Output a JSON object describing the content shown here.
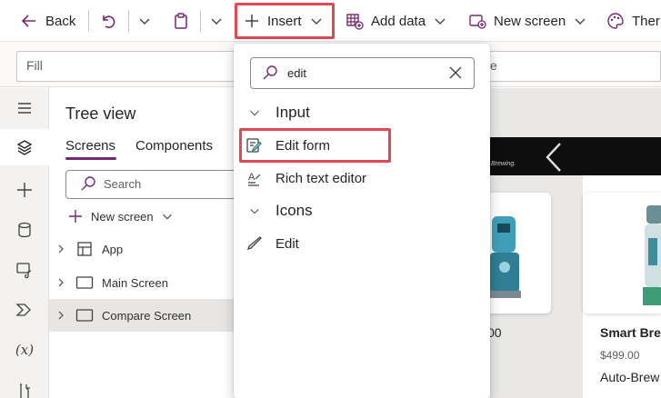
{
  "toolbar": {
    "back_label": "Back",
    "insert_label": "Insert",
    "add_data_label": "Add data",
    "new_screen_label": "New screen",
    "theme_label": "Ther",
    "highlight_color": "#e3474f"
  },
  "formula_bar": {
    "property_value": "Fill",
    "partial_text": "e"
  },
  "left_rail": {
    "icons": [
      "hamburger-icon",
      "layers-icon",
      "plus-icon",
      "database-icon",
      "media-icon",
      "power-automate-icon",
      "variables-icon",
      "tools-icon"
    ],
    "variables_glyph": "(x)"
  },
  "tree_view": {
    "title": "Tree view",
    "tabs": [
      "Screens",
      "Components"
    ],
    "active_tab_color": "#742774",
    "search_placeholder": "Search",
    "new_screen_label": "New screen",
    "items": [
      {
        "label": "App"
      },
      {
        "label": "Main Screen"
      },
      {
        "label": "Compare Screen"
      }
    ]
  },
  "insert_menu": {
    "search_value": "edit",
    "groups": [
      {
        "label": "Input",
        "items": [
          {
            "label": "Edit form"
          },
          {
            "label": "Rich text editor"
          }
        ]
      },
      {
        "label": "Icons",
        "items": [
          {
            "label": "Edit"
          }
        ]
      }
    ]
  },
  "canvas": {
    "brand_text": "Brewing.",
    "left_card_price_fragment": "00",
    "right_card": {
      "title": "Smart Bre",
      "price": "$499.00",
      "subtitle": "Auto-Brew"
    }
  }
}
